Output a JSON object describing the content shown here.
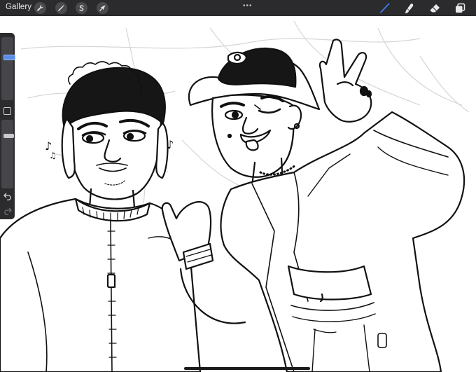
{
  "app": {
    "gallery_label": "Gallery",
    "more_menu_glyph": "•••"
  },
  "toolbar_left": [
    {
      "name": "actions-wrench-icon"
    },
    {
      "name": "adjustments-magic-icon"
    },
    {
      "name": "selection-s-icon"
    },
    {
      "name": "transform-arrow-icon"
    }
  ],
  "toolbar_right": [
    {
      "name": "brush-icon",
      "active": true
    },
    {
      "name": "smudge-icon",
      "active": false
    },
    {
      "name": "eraser-icon",
      "active": false
    },
    {
      "name": "layers-icon",
      "active": false
    }
  ],
  "sidebar": {
    "brush_size": 0.28,
    "brush_opacity": 0.2,
    "modifier_icon": "square-modifier-icon",
    "undo_icon": "undo-arrow-icon",
    "redo_icon": "redo-arrow-icon"
  },
  "colors": {
    "toolbar_bg": "#2b2b2d",
    "active_tool": "#3b7cf5",
    "ink": "#111111",
    "sketch_lines": "#d6d6d6"
  },
  "canvas": {
    "music_note_icon": "music-note-icon"
  }
}
